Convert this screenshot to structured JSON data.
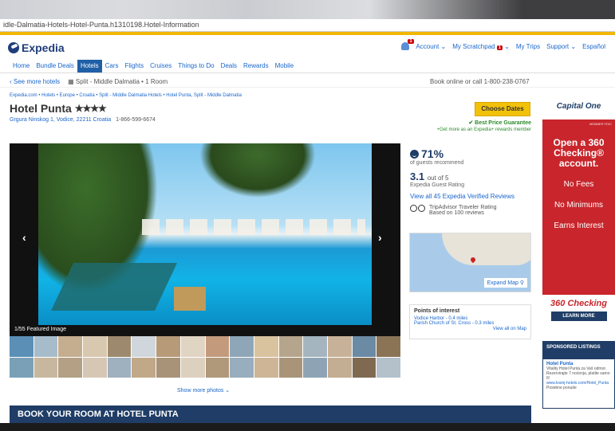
{
  "browser": {
    "url": "idle-Dalmatia-Hotels-Hotel-Punta.h1310198.Hotel-Information"
  },
  "header": {
    "brand": "Expedia",
    "notifications_count": "1",
    "links": {
      "account": "Account ⌄",
      "scratchpad": "My Scratchpad",
      "scratchpad_count": "1",
      "trips": "My Trips",
      "support": "Support ⌄",
      "language": "Español"
    }
  },
  "nav": {
    "items": [
      "Home",
      "Bundle Deals",
      "Hotels",
      "Cars",
      "Flights",
      "Cruises",
      "Things to Do",
      "Deals",
      "Rewards",
      "Mobile"
    ],
    "active": "Hotels"
  },
  "subbar": {
    "back": "‹ See more hotels",
    "search": "Split - Middle Dalmatia • 1 Room",
    "phone": "Book online or call 1-800-238-0767"
  },
  "breadcrumb": "Expedia.com • Hotels • Europe • Croatia • Split - Middle Dalmatia Hotels • Hotel Punta, Split - Middle Dalmatia",
  "hotel": {
    "name": "Hotel Punta",
    "stars": "★★★★",
    "address": "Grgura Ninskog 1, Vodice, 22211 Croatia",
    "phone": "1-866-599-6674"
  },
  "booking": {
    "choose_dates": "Choose Dates",
    "best_price": "✔ Best Price Guarantee",
    "rewards": "+Get more as an Expedia+ rewards member"
  },
  "gallery": {
    "caption": "1/55 Featured Image",
    "show_more": "Show more photos ⌄",
    "prev": "‹",
    "next": "›"
  },
  "ratings": {
    "recommend_pct": "71%",
    "recommend_label": "of guests recommend",
    "score": "3.1",
    "score_suffix": "out of 5",
    "score_label": "Expedia Guest Rating",
    "reviews_link": "View all 45 Expedia Verified Reviews",
    "tripadvisor_label": "TripAdvisor Traveler Rating",
    "tripadvisor_reviews": "Based on 100 reviews"
  },
  "map": {
    "expand": "Expand Map"
  },
  "poi": {
    "title": "Points of interest",
    "items": [
      "Vodice Harbor - 0.4 miles",
      "Parish Church of St. Cross - 0.3 miles"
    ],
    "view_all": "View all on Map"
  },
  "book_bar": "BOOK YOUR ROOM AT HOTEL PUNTA",
  "ad": {
    "brand": "Capital One",
    "fdic": "MEMBER FDIC",
    "headline": "Open a 360 Checking® account.",
    "f1": "No Fees",
    "f2": "No Minimums",
    "f3": "Earns Interest",
    "product": "360 Checking",
    "cta": "LEARN MORE"
  },
  "sponsored": {
    "title": "SPONSORED LISTINGS",
    "name": "Hotel Punta",
    "desc": "Vitality Hotel Punta za Vaš odmor. Rezervirajte 7 noćenja, platite samo 6!",
    "url": "www.losinj-hotels.com/Hotel_Punta",
    "note": "Posebne ponude"
  }
}
